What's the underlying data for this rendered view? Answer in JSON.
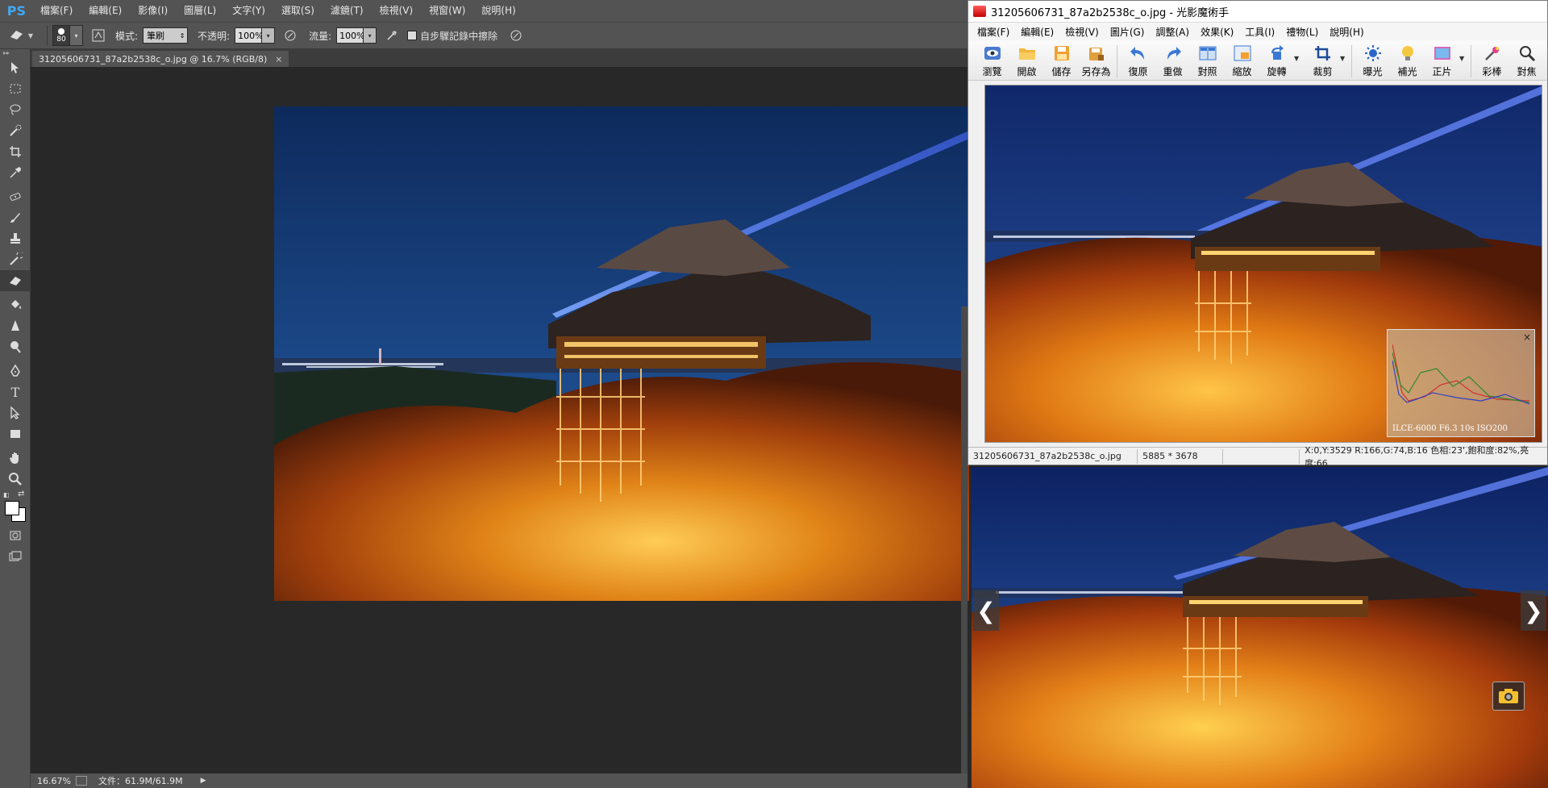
{
  "photoshop": {
    "logo": "PS",
    "menu": [
      "檔案(F)",
      "編輯(E)",
      "影像(I)",
      "圖層(L)",
      "文字(Y)",
      "選取(S)",
      "濾鏡(T)",
      "檢視(V)",
      "視窗(W)",
      "說明(H)"
    ],
    "options": {
      "brush_size": "80",
      "mode_label": "模式:",
      "mode_value": "筆刷",
      "opacity_label": "不透明:",
      "opacity_value": "100%",
      "flow_label": "流量:",
      "flow_value": "100%",
      "erase_history_label": "自步驟記錄中擦除"
    },
    "document_tab": "31205606731_87a2b2538c_o.jpg @ 16.7% (RGB/8)",
    "document_tab_close": "×",
    "status": {
      "zoom": "16.67%",
      "file_info": "文件：61.9M/61.9M"
    }
  },
  "viewer_app": {
    "title": "31205606731_87a2b2538c_o.jpg - 光影魔術手",
    "menu": [
      "檔案(F)",
      "編輯(E)",
      "檢視(V)",
      "圖片(G)",
      "調整(A)",
      "效果(K)",
      "工具(I)",
      "禮物(L)",
      "說明(H)"
    ],
    "toolbar": {
      "browse": "瀏覽",
      "open": "開啟",
      "save": "儲存",
      "save_as": "另存為",
      "undo": "復原",
      "redo": "重做",
      "compare": "對照",
      "resize": "縮放",
      "rotate": "旋轉",
      "crop": "裁剪",
      "exposure": "曝光",
      "fill_light": "補光",
      "positive": "正片",
      "color": "彩棒",
      "focus": "對焦"
    },
    "histogram_close": "×",
    "exif": "ILCE-6000 F6.3 10s ISO200",
    "status": {
      "filename": "31205606731_87a2b2538c_o.jpg",
      "dimensions": "5885 * 3678",
      "pixel_info": "X:0,Y:3529 R:166,G:74,B:16 色相:23',飽和度:82%,亮度:66"
    }
  },
  "bottom_viewer": {
    "prev_arrow": "❮",
    "next_arrow": "❯"
  }
}
